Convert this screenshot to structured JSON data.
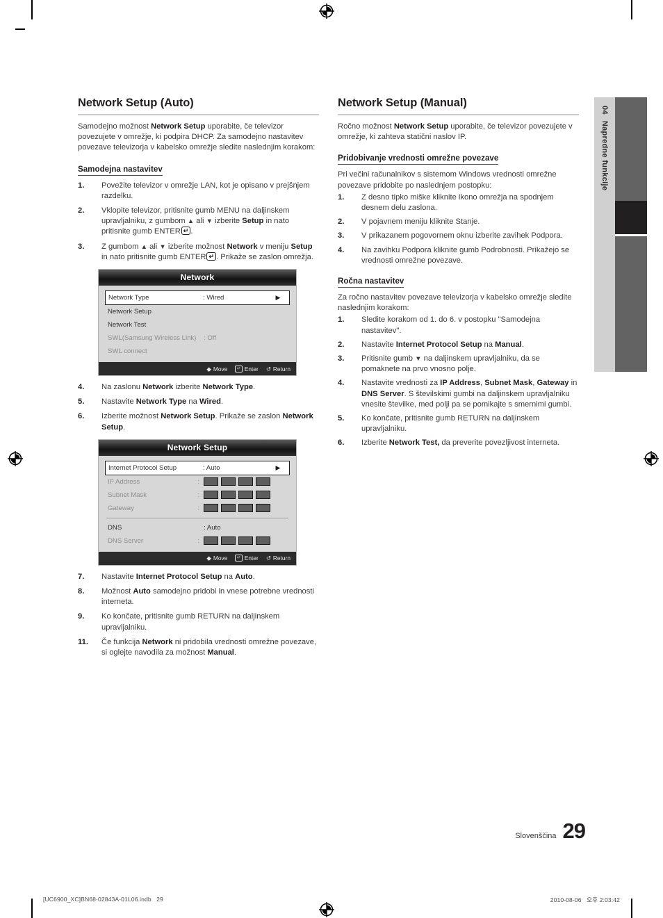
{
  "page": {
    "language_label": "Slovenščina",
    "page_number": "29",
    "chapter_number": "04",
    "chapter_title": "Napredne funkcije",
    "print_footer_left": "[UC6900_XC]BN68-02843A-01L06.indb   29",
    "print_footer_right": "2010-08-06   오후 2:03:42"
  },
  "left_column": {
    "title": "Network Setup (Auto)",
    "lead": "Samodejno možnost <b>Network Setup</b> uporabite, če televizor povezujete v omrežje, ki podpira DHCP. Za samodejno nastavitev povezave televizorja v kabelsko omrežje sledite naslednjim korakom:",
    "subheading": "Samodejna nastavitev",
    "steps_1_3": [
      {
        "num": "1.",
        "html": "Povežite televizor v omrežje LAN, kot je opisano v prejšnjem razdelku."
      },
      {
        "num": "2.",
        "html": "Vklopite televizor, pritisnite gumb MENU na daljinskem upravljalniku, z gumbom <span class=\"arw\">▲</span> ali <span class=\"arw\">▼</span> izberite <b>Setup</b> in nato pritisnite gumb ENTER<span class=\"ent-key\">↵</span>."
      },
      {
        "num": "3.",
        "html": "Z gumbom <span class=\"arw\">▲</span> ali <span class=\"arw\">▼</span> izberite možnost <b>Network</b> v meniju <b>Setup</b>&nbsp; in nato pritisnite gumb ENTER<span class=\"ent-key\">↵</span>. Prikaže se zaslon omrežja."
      }
    ],
    "steps_4_6": [
      {
        "num": "4.",
        "html": "Na zaslonu <b>Network</b> izberite <b>Network Type</b>."
      },
      {
        "num": "5.",
        "html": "Nastavite <b>Network Type</b> na <b>Wired</b>."
      },
      {
        "num": "6.",
        "html": "Izberite možnost <b>Network Setup</b>. Prikaže se zaslon <b>Network Setup</b>."
      }
    ],
    "steps_7_11": [
      {
        "num": "7.",
        "html": "Nastavite <b>Internet Protocol Setup</b> na <b>Auto</b>."
      },
      {
        "num": "8.",
        "html": "Možnost <b>Auto</b> samodejno pridobi in vnese potrebne vrednosti interneta."
      },
      {
        "num": "9.",
        "html": "Ko končate, pritisnite gumb RETURN na daljinskem upravljalniku."
      },
      {
        "num": "11.",
        "html": "Če funkcija <b>Network</b> ni pridobila vrednosti omrežne povezave, si oglejte navodila za možnost <b>Manual</b>."
      }
    ]
  },
  "right_column": {
    "title": "Network Setup (Manual)",
    "lead": "Ročno možnost <b>Network Setup</b> uporabite, če televizor povezujete v omrežje, ki zahteva statični naslov IP.",
    "subheading_1": "Pridobivanje vrednosti omrežne povezave",
    "sub_lead_1": "Pri večini računalnikov s sistemom Windows vrednosti omrežne povezave pridobite po naslednjem postopku:",
    "steps_a": [
      {
        "num": "1.",
        "html": "Z desno tipko miške kliknite ikono omrežja na spodnjem desnem delu zaslona."
      },
      {
        "num": "2.",
        "html": "V pojavnem meniju kliknite Stanje."
      },
      {
        "num": "3.",
        "html": "V prikazanem pogovornem oknu izberite zavihek Podpora."
      },
      {
        "num": "4.",
        "html": "Na zavihku Podpora kliknite gumb Podrobnosti. Prikažejo se vrednosti omrežne povezave."
      }
    ],
    "subheading_2": "Ročna nastavitev",
    "sub_lead_2": "Za ročno nastavitev povezave televizorja v kabelsko omrežje sledite naslednjim korakom:",
    "steps_b": [
      {
        "num": "1.",
        "html": "Sledite korakom od 1. do 6. v postopku \"Samodejna nastavitev\"."
      },
      {
        "num": "2.",
        "html": "Nastavite <b>Internet Protocol Setup</b> na <b>Manual</b>."
      },
      {
        "num": "3.",
        "html": "Pritisnite gumb <span class=\"arw\">▼</span> na daljinskem upravljalniku, da se pomaknete na prvo vnosno polje."
      },
      {
        "num": "4.",
        "html": "Nastavite vrednosti za <b>IP Address</b>, <b>Subnet Mask</b>, <b>Gateway</b> in <b>DNS Server</b>. S številskimi gumbi na daljinskem upravljalniku vnesite številke, med polji pa se pomikajte s smernimi gumbi."
      },
      {
        "num": "5.",
        "html": "Ko končate, pritisnite gumb RETURN na daljinskem upravljalniku."
      },
      {
        "num": "6.",
        "html": "Izberite <b>Network Test,</b> da preverite povezljivost interneta."
      }
    ]
  },
  "osd_network": {
    "title": "Network",
    "rows": [
      {
        "label": "Network Type",
        "value": ": Wired",
        "selected": true,
        "dim": false,
        "caret": "▶"
      },
      {
        "label": "Network Setup",
        "value": "",
        "selected": false,
        "dim": false,
        "caret": ""
      },
      {
        "label": "Network Test",
        "value": "",
        "selected": false,
        "dim": false,
        "caret": ""
      },
      {
        "label": "SWL(Samsung Wireless Link)",
        "value": ": Off",
        "selected": false,
        "dim": true,
        "caret": ""
      },
      {
        "label": "SWL connect",
        "value": "",
        "selected": false,
        "dim": true,
        "caret": ""
      }
    ],
    "footer": {
      "move": "Move",
      "enter": "Enter",
      "return": "Return"
    }
  },
  "osd_network_setup": {
    "title": "Network Setup",
    "rows": [
      {
        "label": "Internet Protocol Setup",
        "value": ": Auto",
        "selected": true,
        "dim": false,
        "caret": "▶",
        "octets": 0
      },
      {
        "label": "IP Address",
        "value": "",
        "selected": false,
        "dim": true,
        "caret": "",
        "octets": 4
      },
      {
        "label": "Subnet Mask",
        "value": "",
        "selected": false,
        "dim": true,
        "caret": "",
        "octets": 4
      },
      {
        "label": "Gateway",
        "value": "",
        "selected": false,
        "dim": true,
        "caret": "",
        "octets": 4
      },
      {
        "separator": true
      },
      {
        "label": "DNS",
        "value": ": Auto",
        "selected": false,
        "dim": false,
        "caret": "",
        "octets": 0
      },
      {
        "label": "DNS Server",
        "value": "",
        "selected": false,
        "dim": true,
        "caret": "",
        "octets": 4
      }
    ],
    "footer": {
      "move": "Move",
      "enter": "Enter",
      "return": "Return"
    }
  }
}
